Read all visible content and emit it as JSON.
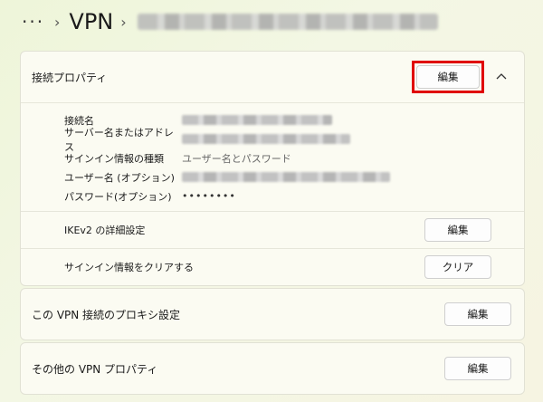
{
  "breadcrumb": {
    "more": "···",
    "separator": "›",
    "vpn": "VPN"
  },
  "connection_properties": {
    "title": "接続プロパティ",
    "edit_label": "編集",
    "fields": [
      {
        "label": "接続名",
        "value": ""
      },
      {
        "label": "サーバー名またはアドレス",
        "value": ""
      },
      {
        "label": "サインイン情報の種類",
        "value": "ユーザー名とパスワード"
      },
      {
        "label": "ユーザー名 (オプション)",
        "value": ""
      },
      {
        "label": "パスワード(オプション)",
        "value": "••••••••"
      }
    ],
    "ikev2": {
      "label": "IKEv2 の詳細設定",
      "button": "編集"
    },
    "clear_signin": {
      "label": "サインイン情報をクリアする",
      "button": "クリア"
    }
  },
  "proxy_settings": {
    "title": "この VPN 接続のプロキシ設定",
    "button": "編集"
  },
  "other_properties": {
    "title": "その他の VPN プロパティ",
    "button": "編集"
  },
  "colors": {
    "highlight": "#e00000",
    "card_background": "#fbfbf2"
  }
}
